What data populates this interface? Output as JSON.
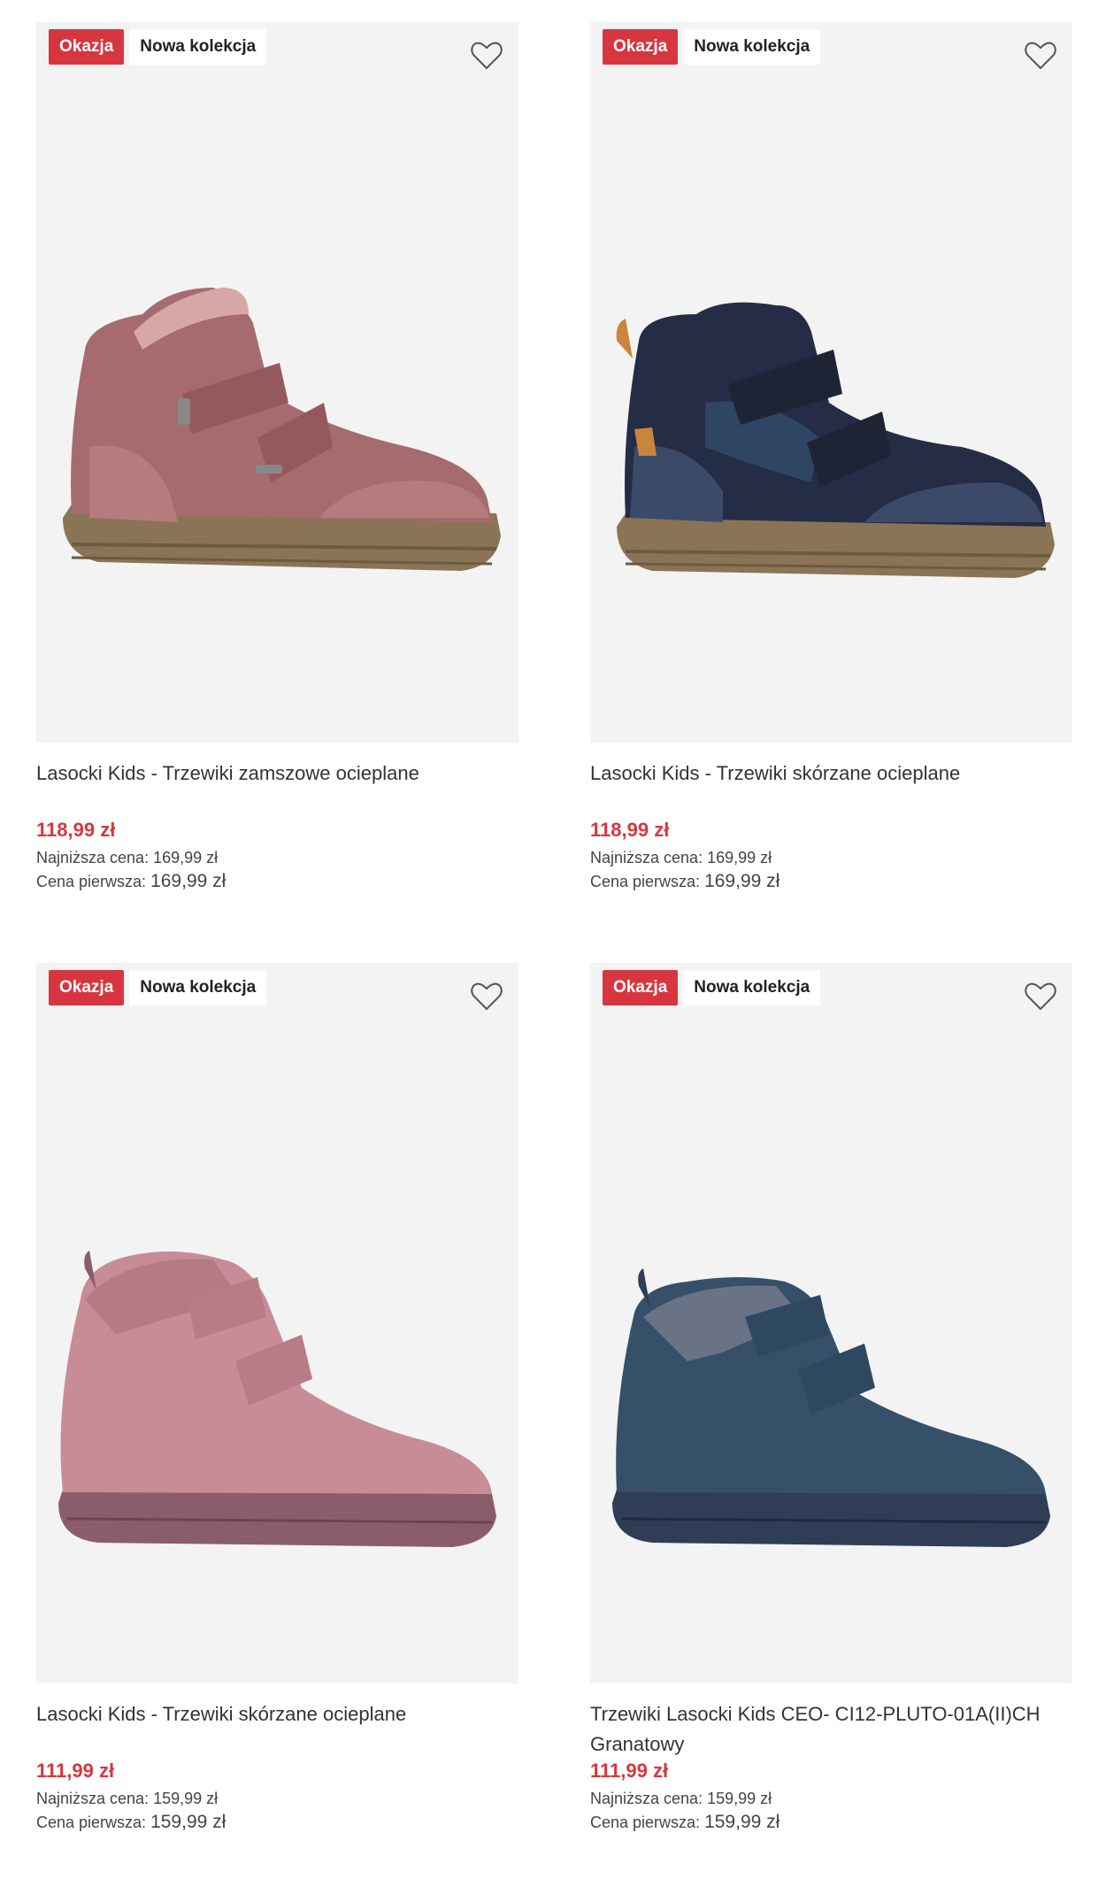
{
  "badges": {
    "sale": "Okazja",
    "new": "Nowa kolekcja"
  },
  "labels": {
    "lowest_price": "Najniższa cena:",
    "first_price": "Cena pierwsza:"
  },
  "colors": {
    "accent_red": "#d8363e",
    "image_bg": "#f3f3f3"
  },
  "products": [
    {
      "title": "Lasocki Kids - Trzewiki zamszowe ocieplane",
      "price": "118,99 zł",
      "lowest_price": "169,99 zł",
      "first_price": "169,99 zł",
      "shoe_color": "#a66b6e",
      "sole_color": "#8a7456",
      "wishlist_icon": "heart-outline-icon"
    },
    {
      "title": "Lasocki Kids - Trzewiki skórzane ocieplane",
      "price": "118,99 zł",
      "lowest_price": "169,99 zł",
      "first_price": "169,99 zł",
      "shoe_color": "#252c45",
      "sole_color": "#8a7456",
      "wishlist_icon": "heart-outline-icon"
    },
    {
      "title": "Lasocki Kids - Trzewiki skórzane ocieplane",
      "price": "111,99 zł",
      "lowest_price": "159,99 zł",
      "first_price": "159,99 zł",
      "shoe_color": "#c88c97",
      "sole_color": "#8b5d6a",
      "wishlist_icon": "heart-outline-icon"
    },
    {
      "title": "Trzewiki Lasocki Kids CEO- CI12-PLUTO-01A(II)CH Granatowy",
      "price": "111,99 zł",
      "lowest_price": "159,99 zł",
      "first_price": "159,99 zł",
      "shoe_color": "#36506a",
      "sole_color": "#2f3e56",
      "wishlist_icon": "heart-outline-icon"
    }
  ]
}
